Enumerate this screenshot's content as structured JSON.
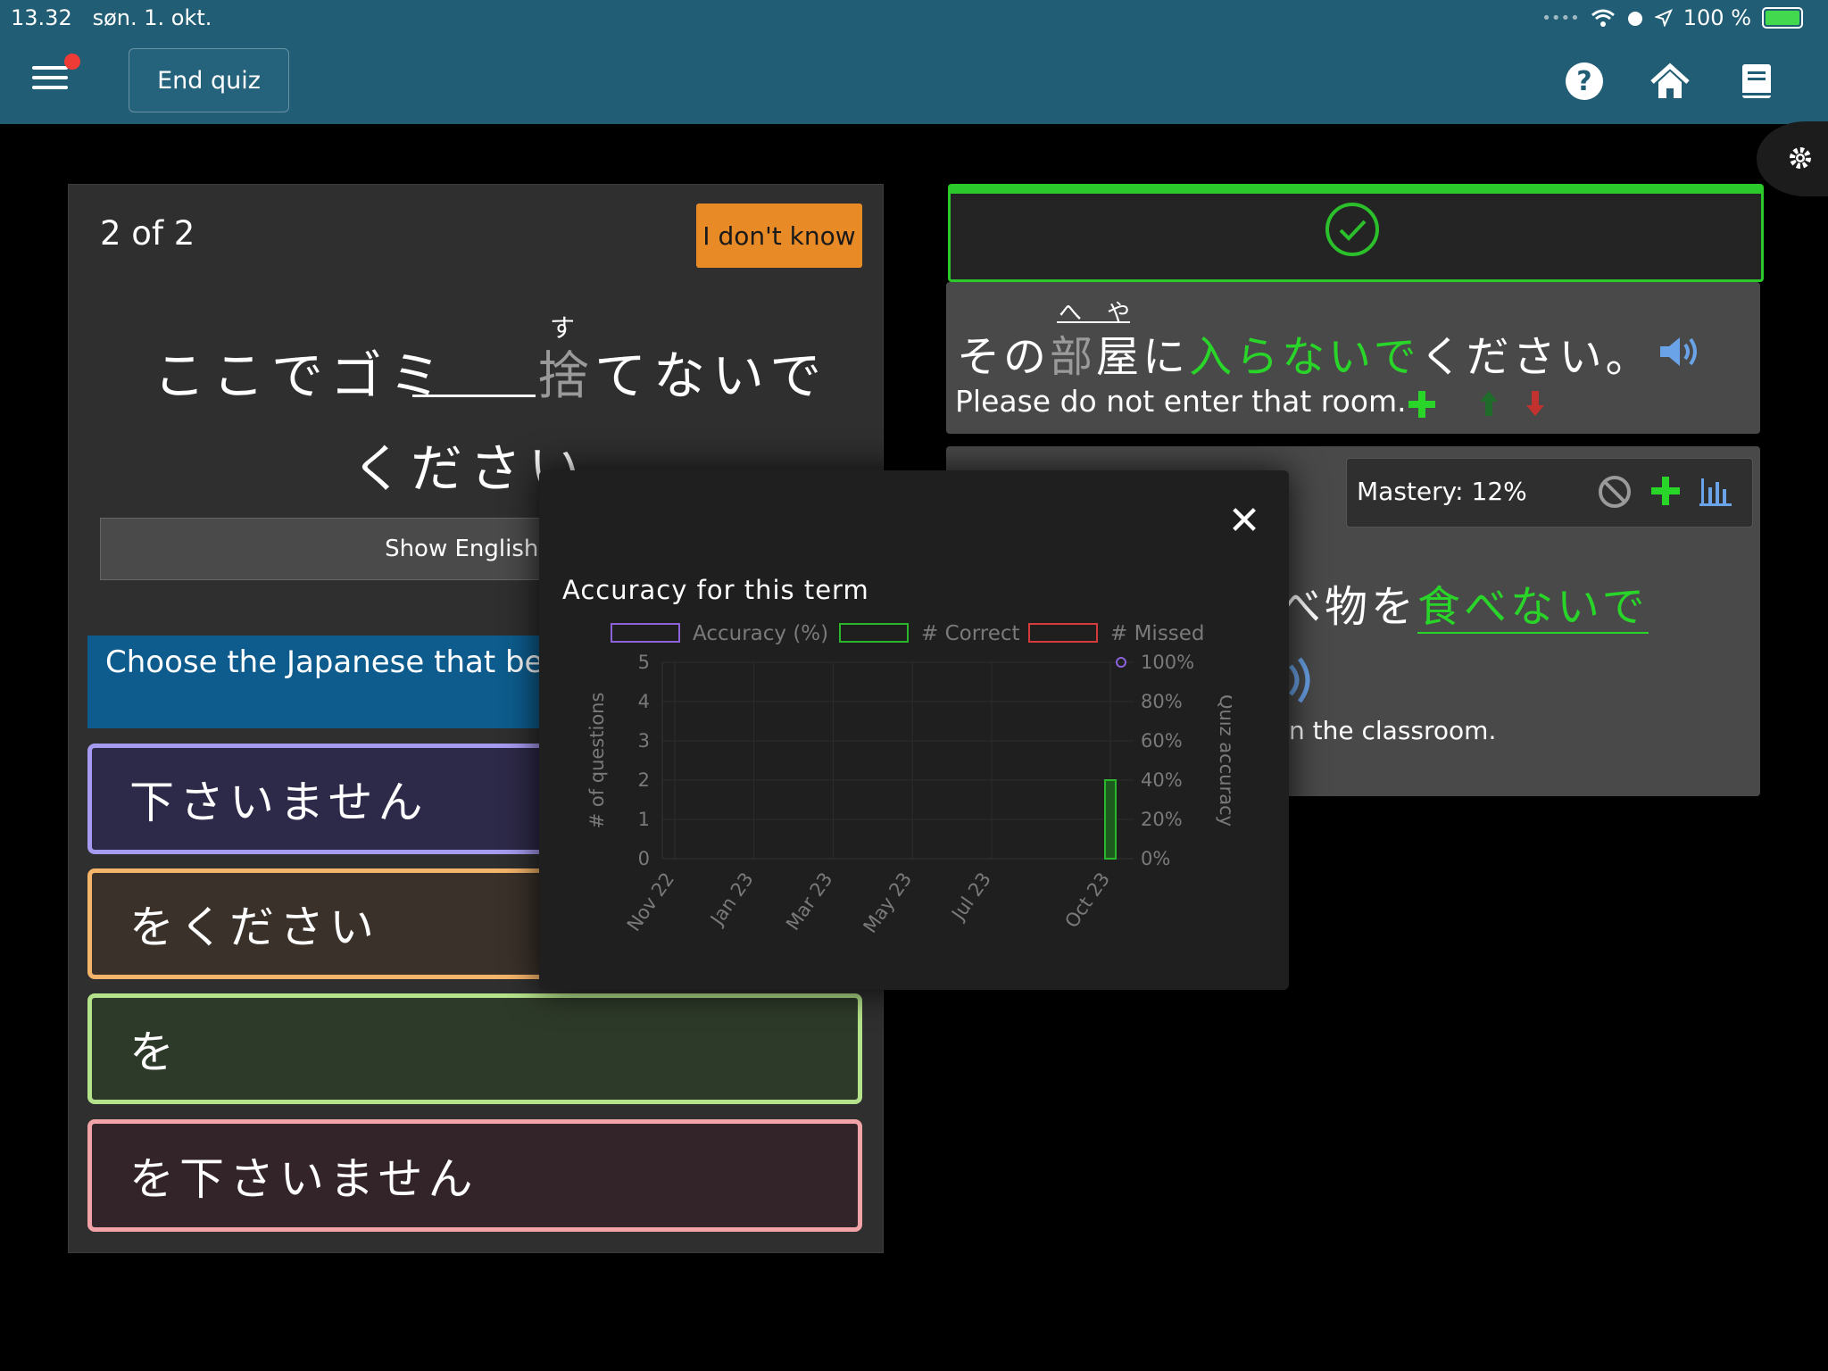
{
  "status": {
    "time": "13.32",
    "date": "søn. 1. okt.",
    "battery": "100 %"
  },
  "header": {
    "end_quiz": "End quiz",
    "icons": [
      "menu-icon",
      "help-icon",
      "home-icon",
      "book-icon",
      "gear-icon"
    ]
  },
  "quiz": {
    "counter": "2 of 2",
    "dont_know": "I don't know",
    "question_part1": "ここでゴミ",
    "question_kanji": "捨",
    "question_furigana": "す",
    "question_part2": "てないで",
    "question_line2": "ください",
    "show_english": "Show English tran",
    "instruction": "Choose the Japanese that best sentence.",
    "choices": [
      "下さいません",
      "をください",
      "を",
      "を下さいません"
    ]
  },
  "right": {
    "sentence1_prefix": "その",
    "sentence1_kanji_a": "部",
    "sentence1_kanji_b": "屋",
    "sentence1_furigana_a": "へ",
    "sentence1_furigana_b": "や",
    "sentence1_ni": "に",
    "sentence1_green": "入らないで",
    "sentence1_suffix": "ください。",
    "sentence1_english": "Please do not enter that room.",
    "mastery_label": "Mastery:",
    "mastery_value": "12%",
    "sentence2_visible": "べ物を",
    "sentence2_green": "食べないで",
    "sentence2_english": "n the classroom."
  },
  "modal": {
    "close": "✕",
    "title": "Accuracy for this term"
  },
  "chart_data": {
    "type": "bar",
    "title": "Accuracy for this term",
    "legend": [
      "Accuracy (%)",
      "# Correct",
      "# Missed"
    ],
    "legend_placement": "top",
    "colors": {
      "accuracy": "#8b63d9",
      "correct": "#2bb62b",
      "missed": "#d63a3a"
    },
    "categories": [
      "Nov 22",
      "Jan 23",
      "Mar 23",
      "May 23",
      "Jul 23",
      "Oct 23"
    ],
    "ylabel_left": "# of questions",
    "ylabel_right": "Quiz accuracy",
    "y_left_ticks": [
      "0",
      "1",
      "2",
      "3",
      "4",
      "5"
    ],
    "y_right_ticks": [
      "0%",
      "20%",
      "40%",
      "60%",
      "80%",
      "100%"
    ],
    "ylim_left": [
      0,
      5
    ],
    "ylim_right": [
      0,
      100
    ],
    "series": [
      {
        "name": "# Correct",
        "x": "Oct 23",
        "values": [
          2
        ]
      },
      {
        "name": "Accuracy (%)",
        "x": "Oct 23",
        "values": [
          100
        ]
      }
    ],
    "grid": true
  }
}
